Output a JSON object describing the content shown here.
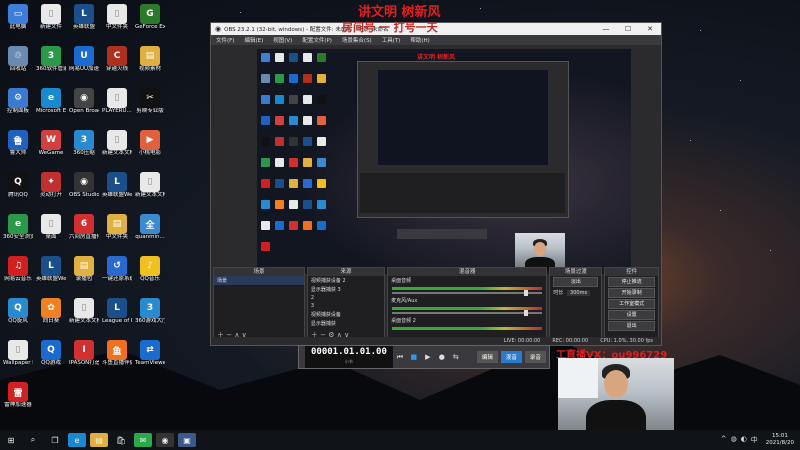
{
  "desktop_icons": [
    {
      "label": "此电脑",
      "color": "#3d7fd8",
      "glyph": "▭"
    },
    {
      "label": "新建文件",
      "color": "#e8e8e8",
      "glyph": "▯"
    },
    {
      "label": "英雄联盟",
      "color": "#1b4f8a",
      "glyph": "L"
    },
    {
      "label": "中文件夹",
      "color": "#e8e8e8",
      "glyph": "▯"
    },
    {
      "label": "GeForce Experience",
      "color": "#2a7a2a",
      "glyph": "G"
    },
    {
      "label": "回收站",
      "color": "#6a8ab0",
      "glyph": "♲"
    },
    {
      "label": "360软件管家",
      "color": "#2a9a4a",
      "glyph": "3"
    },
    {
      "label": "网易UU加速器",
      "color": "#1a6ad0",
      "glyph": "U"
    },
    {
      "label": "穿越火线",
      "color": "#b03020",
      "glyph": "C"
    },
    {
      "label": "视频素材",
      "color": "#e0b040",
      "glyph": "▤"
    },
    {
      "label": "控制面板",
      "color": "#3a7ad0",
      "glyph": "⚙"
    },
    {
      "label": "Microsoft Edge",
      "color": "#1a8ad0",
      "glyph": "e"
    },
    {
      "label": "Open Broadcast...",
      "color": "#444",
      "glyph": "◉"
    },
    {
      "label": "PLAYERU... BATTLEGR...",
      "color": "#e8e8e8",
      "glyph": "▯"
    },
    {
      "label": "剪映专业版",
      "color": "#111",
      "glyph": "✂"
    },
    {
      "label": "鲁大师",
      "color": "#2060c0",
      "glyph": "鲁"
    },
    {
      "label": "WeGame",
      "color": "#d04040",
      "glyph": "W"
    },
    {
      "label": "360压缩",
      "color": "#2a8ad0",
      "glyph": "3"
    },
    {
      "label": "新建文本文档",
      "color": "#e8e8e8",
      "glyph": "▯"
    },
    {
      "label": "小桃电影",
      "color": "#e06040",
      "glyph": "▶"
    },
    {
      "label": "腾讯QQ",
      "color": "#111",
      "glyph": "Q"
    },
    {
      "label": "灵动打开",
      "color": "#c03030",
      "glyph": "✦"
    },
    {
      "label": "OBS Studio",
      "color": "#333",
      "glyph": "◉"
    },
    {
      "label": "英雄联盟WeGame版",
      "color": "#1b4f8a",
      "glyph": "L"
    },
    {
      "label": "新建文本文档(2)",
      "color": "#e8e8e8",
      "glyph": "▯"
    },
    {
      "label": "360安全浏览器",
      "color": "#2a9a4a",
      "glyph": "e"
    },
    {
      "label": "桌面",
      "color": "#e8e8e8",
      "glyph": "▯"
    },
    {
      "label": "六间房直播伴侣",
      "color": "#d03030",
      "glyph": "6"
    },
    {
      "label": "中文件夹",
      "color": "#e0b040",
      "glyph": "▤"
    },
    {
      "label": "quanmin...",
      "color": "#3a8ad0",
      "glyph": "全"
    },
    {
      "label": "网易云音乐",
      "color": "#d02020",
      "glyph": "♫"
    },
    {
      "label": "英雄联盟WeGame版",
      "color": "#1b4f8a",
      "glyph": "L"
    },
    {
      "label": "录播包",
      "color": "#e0b040",
      "glyph": "▤"
    },
    {
      "label": "一键还原系统",
      "color": "#2a6ad0",
      "glyph": "↺"
    },
    {
      "label": "QQ音乐",
      "color": "#f0c020",
      "glyph": "♪"
    },
    {
      "label": "QQ旋风",
      "color": "#2a8ad0",
      "glyph": "Q"
    },
    {
      "label": "向日葵",
      "color": "#f08020",
      "glyph": "✿"
    },
    {
      "label": "新建文本文档(3)",
      "color": "#e8e8e8",
      "glyph": "▯"
    },
    {
      "label": "League of Legends",
      "color": "#1b4f8a",
      "glyph": "L"
    },
    {
      "label": "360游戏大厅",
      "color": "#2a8ad0",
      "glyph": "3"
    },
    {
      "label": "Wallpaper Engine",
      "color": "#e8e8e8",
      "glyph": "▯"
    },
    {
      "label": "QQ游戏",
      "color": "#1a6ad0",
      "glyph": "Q"
    },
    {
      "label": "IPASON打造软件",
      "color": "#d03030",
      "glyph": "I"
    },
    {
      "label": "斗鱼直播伴侣",
      "color": "#f07020",
      "glyph": "鱼"
    },
    {
      "label": "TeamViewer",
      "color": "#1a6ad0",
      "glyph": "⇄"
    },
    {
      "label": "雷神加速器",
      "color": "#d02020",
      "glyph": "雷"
    }
  ],
  "obs": {
    "title": "OBS 23.2.1 (32-bit, windows) - 配置文件: 未命名 - 场景: 未命名",
    "menu": [
      "文件(F)",
      "编辑(E)",
      "视图(V)",
      "配置文件(P)",
      "场景集合(S)",
      "工具(T)",
      "帮助(H)"
    ],
    "docks": {
      "scenes": {
        "title": "场景",
        "items": [
          "场景"
        ]
      },
      "sources": {
        "title": "来源",
        "items": [
          "视频捕获设备 2",
          "显示器捕获 3",
          "2",
          "3",
          "视频捕获设备",
          "显示器捕获"
        ]
      },
      "mixer": {
        "title": "混音器",
        "tracks": [
          "桌面音频",
          "麦克风/Aux",
          "桌面音频 2"
        ]
      },
      "transitions": {
        "title": "场景过渡",
        "type": "淡出",
        "duration_label": "时长",
        "duration": "300ms"
      },
      "controls": {
        "title": "控件",
        "buttons": [
          "停止推流",
          "开始录制",
          "工作室模式",
          "设置",
          "退出"
        ]
      }
    },
    "status": {
      "live": "LIVE: 00:00:00",
      "rec": "REC: 00:00:00",
      "cpu": "CPU: 1.0%, 30.00 fps"
    }
  },
  "overlays": {
    "top_title": "讲文明 树新风",
    "top_subtitle": "房间号 一 打号一天",
    "inner_title": "讲文明 树新风",
    "contact": "工直播VX：ou996729"
  },
  "toolbar": {
    "timecode": "00001.01.01.00",
    "timecode_sub": "小节",
    "buttons": [
      "编辑",
      "混音",
      "录音"
    ]
  },
  "clock": {
    "time": "15:01",
    "date": "2021/8/20"
  },
  "taskbar_icons": [
    "start-icon",
    "search-icon",
    "task-view-icon",
    "edge-icon",
    "explorer-icon",
    "store-icon",
    "wechat-icon",
    "obs-icon",
    "app-icon"
  ]
}
